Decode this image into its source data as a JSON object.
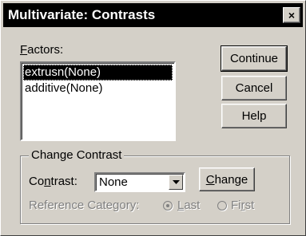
{
  "window": {
    "title": "Multivariate: Contrasts",
    "close_symbol": "×"
  },
  "factors": {
    "label_underlined": "F",
    "label_rest": "actors:",
    "items": [
      {
        "label": "extrusn(None)",
        "selected": true
      },
      {
        "label": "additive(None)",
        "selected": false
      }
    ]
  },
  "buttons": {
    "continue": "Continue",
    "cancel": "Cancel",
    "help": "Help",
    "change_underlined": "C",
    "change_rest": "hange"
  },
  "change_contrast": {
    "group_label": "Change Contrast",
    "contrast_label_pre": "Co",
    "contrast_label_underlined": "n",
    "contrast_label_post": "trast:",
    "contrast_value": "None",
    "reference_label": "Reference Category:",
    "last_underlined": "L",
    "last_rest": "ast",
    "first_pre": "Fi",
    "first_underlined": "r",
    "first_post": "st",
    "last_selected": true
  },
  "icons": {
    "close": "close-icon",
    "dropdown": "chevron-down-icon"
  },
  "colors": {
    "face": "#d4d0c8",
    "titlebar": "#000000",
    "selection": "#000000",
    "disabled": "#808080"
  }
}
